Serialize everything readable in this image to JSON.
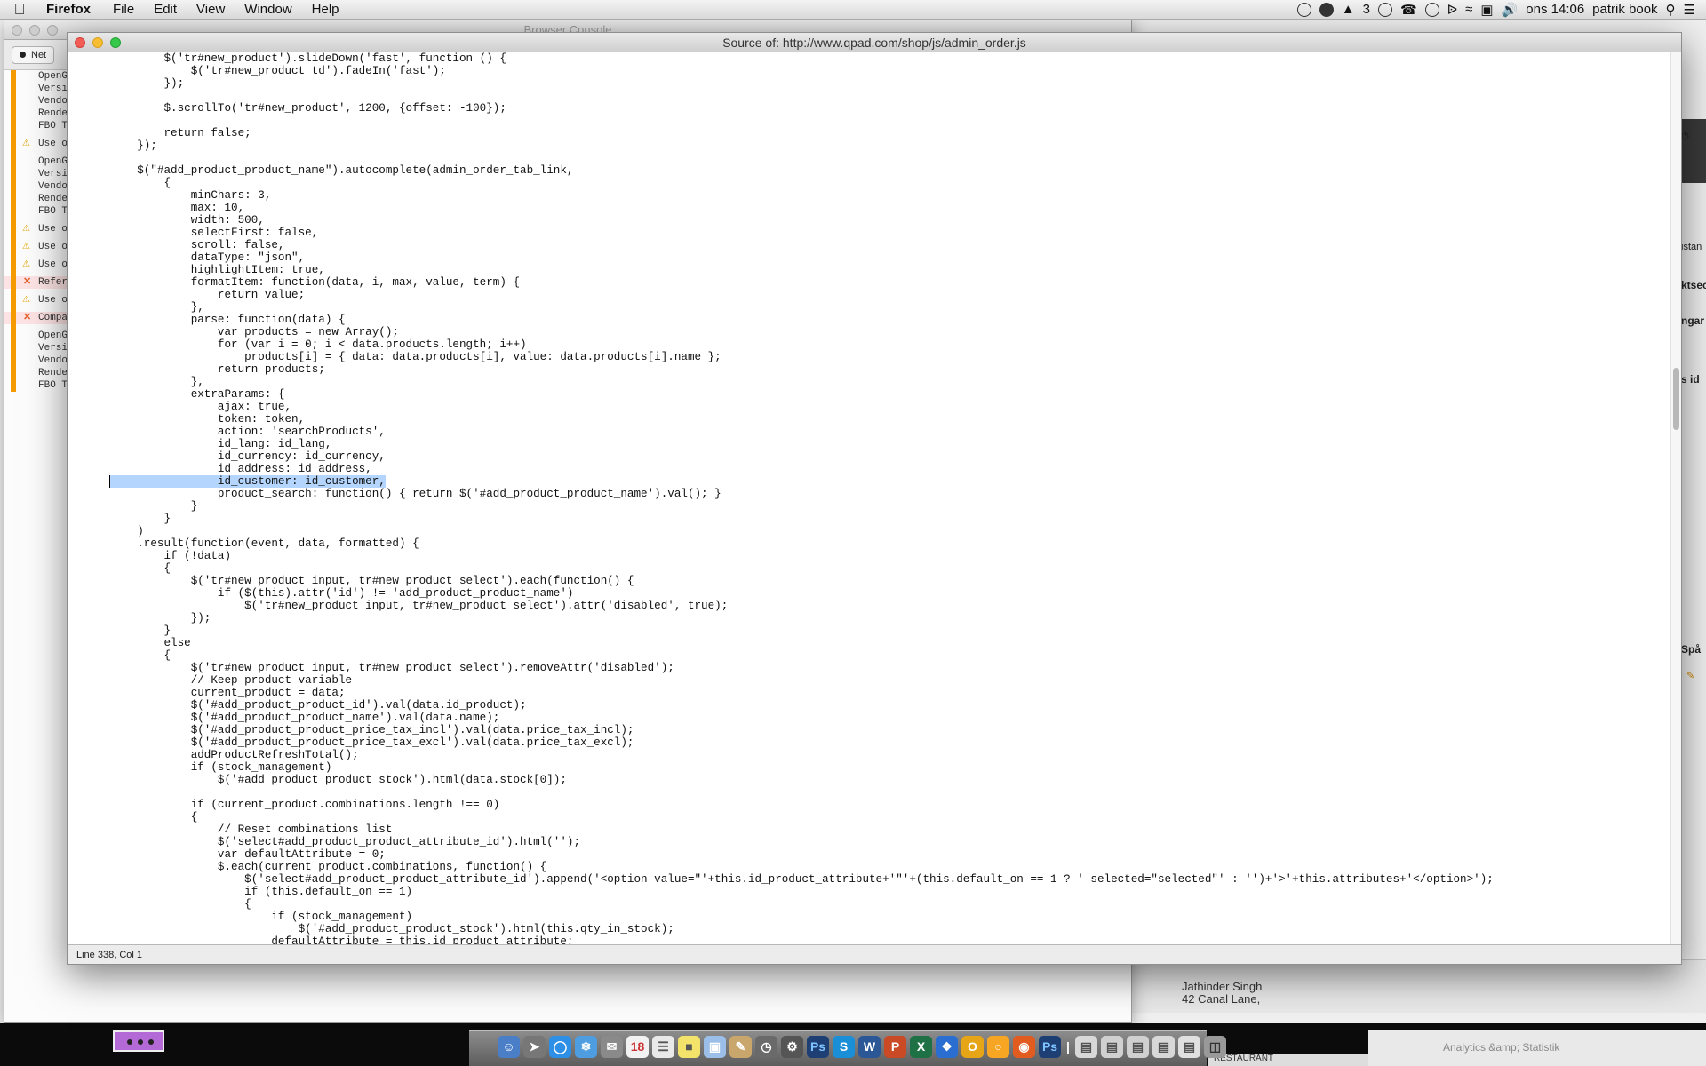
{
  "menubar": {
    "app_name": "Firefox",
    "items": [
      "File",
      "Edit",
      "View",
      "Window",
      "Help"
    ],
    "status_count": "3",
    "clock": "ons 14:06",
    "user": "patrik book"
  },
  "console_window": {
    "title": "Browser Console",
    "net_label": "Net",
    "log": [
      {
        "kind": "info",
        "text": "OpenG"
      },
      {
        "kind": "info",
        "text": "Versi"
      },
      {
        "kind": "info",
        "text": "Vendo"
      },
      {
        "kind": "info",
        "text": "Rende"
      },
      {
        "kind": "info",
        "text": "FBO T"
      },
      {
        "kind": "gap",
        "text": ""
      },
      {
        "kind": "warn",
        "text": "Use o"
      },
      {
        "kind": "gap",
        "text": ""
      },
      {
        "kind": "info",
        "text": "OpenG"
      },
      {
        "kind": "info",
        "text": "Versi"
      },
      {
        "kind": "info",
        "text": "Vendo"
      },
      {
        "kind": "info",
        "text": "Rende"
      },
      {
        "kind": "info",
        "text": "FBO T"
      },
      {
        "kind": "gap",
        "text": ""
      },
      {
        "kind": "warn",
        "text": "Use o"
      },
      {
        "kind": "gap",
        "text": ""
      },
      {
        "kind": "warn",
        "text": "Use o"
      },
      {
        "kind": "gap",
        "text": ""
      },
      {
        "kind": "warn",
        "text": "Use o"
      },
      {
        "kind": "gap",
        "text": ""
      },
      {
        "kind": "err",
        "text": "Refer"
      },
      {
        "kind": "gap",
        "text": ""
      },
      {
        "kind": "warn",
        "text": "Use o"
      },
      {
        "kind": "gap",
        "text": ""
      },
      {
        "kind": "err",
        "text": "Compa"
      },
      {
        "kind": "gap",
        "text": ""
      },
      {
        "kind": "info",
        "text": "OpenG"
      },
      {
        "kind": "info",
        "text": "Versi"
      },
      {
        "kind": "info",
        "text": "Vendo"
      },
      {
        "kind": "info",
        "text": "Rende"
      },
      {
        "kind": "info",
        "text": "FBO T"
      }
    ]
  },
  "right_window": {
    "fragments": [
      "istan",
      "ktsec",
      "ngar",
      "s id",
      "Spå"
    ],
    "address_name": "Jathinder Singh",
    "address_street": "42 Canal Lane,"
  },
  "source_window": {
    "title": "Source of: http://www.qpad.com/shop/js/admin_order.js",
    "status": "Line 338, Col 1",
    "highlight_line": 34,
    "code_lines": [
      "        $('tr#new_product').slideDown('fast', function () {",
      "            $('tr#new_product td').fadeIn('fast');",
      "        });",
      "",
      "        $.scrollTo('tr#new_product', 1200, {offset: -100});",
      "",
      "        return false;",
      "    });",
      "",
      "    $(\"#add_product_product_name\").autocomplete(admin_order_tab_link,",
      "        {",
      "            minChars: 3,",
      "            max: 10,",
      "            width: 500,",
      "            selectFirst: false,",
      "            scroll: false,",
      "            dataType: \"json\",",
      "            highlightItem: true,",
      "            formatItem: function(data, i, max, value, term) {",
      "                return value;",
      "            },",
      "            parse: function(data) {",
      "                var products = new Array();",
      "                for (var i = 0; i < data.products.length; i++)",
      "                    products[i] = { data: data.products[i], value: data.products[i].name };",
      "                return products;",
      "            },",
      "            extraParams: {",
      "                ajax: true,",
      "                token: token,",
      "                action: 'searchProducts',",
      "                id_lang: id_lang,",
      "                id_currency: id_currency,",
      "                id_address: id_address,",
      "                id_customer: id_customer,",
      "                product_search: function() { return $('#add_product_product_name').val(); }",
      "            }",
      "        }",
      "    )",
      "    .result(function(event, data, formatted) {",
      "        if (!data)",
      "        {",
      "            $('tr#new_product input, tr#new_product select').each(function() {",
      "                if ($(this).attr('id') != 'add_product_product_name')",
      "                    $('tr#new_product input, tr#new_product select').attr('disabled', true);",
      "            });",
      "        }",
      "        else",
      "        {",
      "            $('tr#new_product input, tr#new_product select').removeAttr('disabled');",
      "            // Keep product variable",
      "            current_product = data;",
      "            $('#add_product_product_id').val(data.id_product);",
      "            $('#add_product_product_name').val(data.name);",
      "            $('#add_product_product_price_tax_incl').val(data.price_tax_incl);",
      "            $('#add_product_product_price_tax_excl').val(data.price_tax_excl);",
      "            addProductRefreshTotal();",
      "            if (stock_management)",
      "                $('#add_product_product_stock').html(data.stock[0]);",
      "",
      "            if (current_product.combinations.length !== 0)",
      "            {",
      "                // Reset combinations list",
      "                $('select#add_product_product_attribute_id').html('');",
      "                var defaultAttribute = 0;",
      "                $.each(current_product.combinations, function() {",
      "                    $('select#add_product_product_attribute_id').append('<option value=\"'+this.id_product_attribute+'\"'+(this.default_on == 1 ? ' selected=\"selected\"' : '')+'>'+this.attributes+'</option>');",
      "                    if (this.default_on == 1)",
      "                    {",
      "                        if (stock_management)",
      "                            $('#add_product_product_stock').html(this.qty_in_stock);",
      "                        defaultAttribute = this.id_product_attribute;"
    ]
  },
  "taskbar": {
    "restaurant_label": "RESTAURANT",
    "analytics_label": "Analytics &amp; Statistik"
  }
}
